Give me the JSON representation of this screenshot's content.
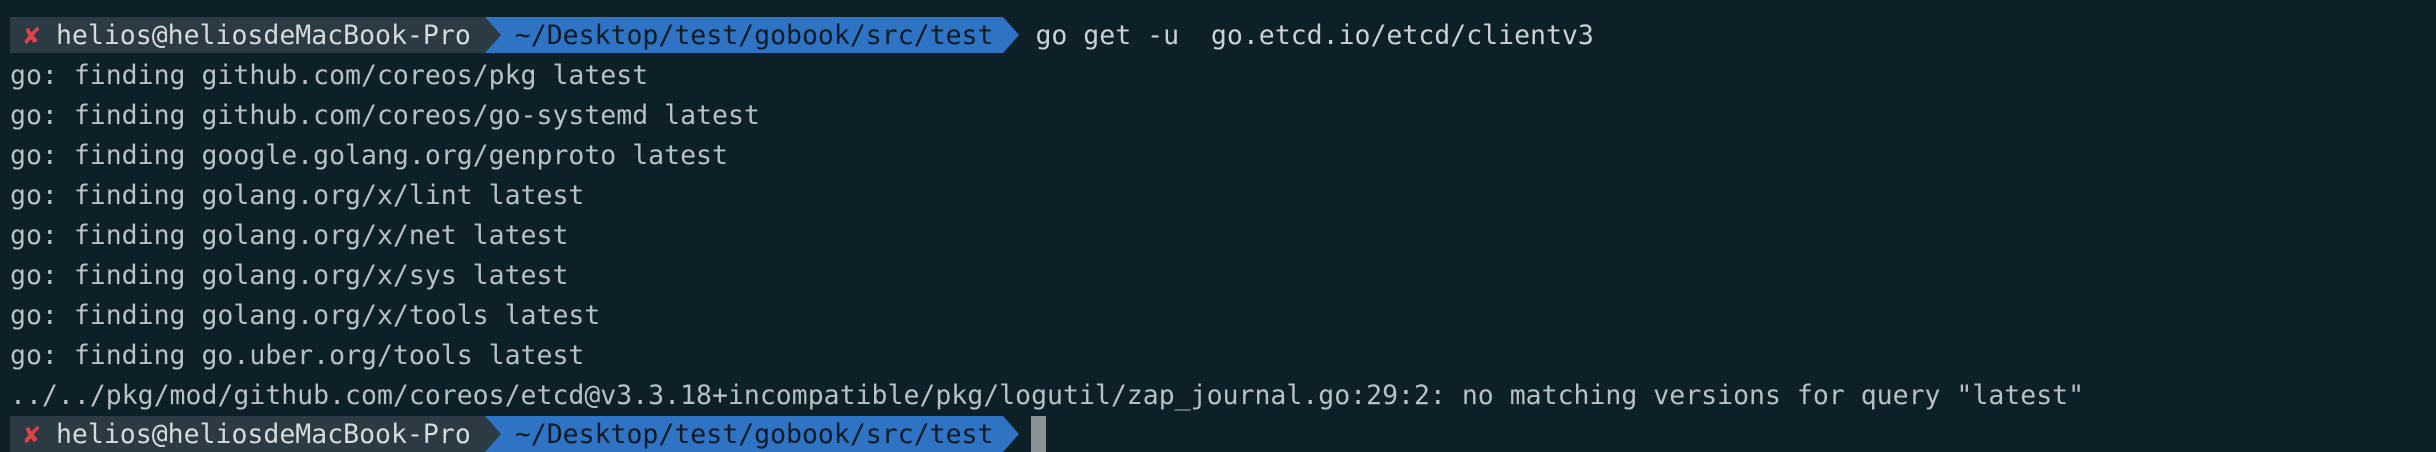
{
  "terminal": {
    "top_fragment": "~",
    "prompts": [
      {
        "status_icon": "✘",
        "user_host": "helios@heliosdeMacBook-Pro",
        "cwd": "~/Desktop/test/gobook/src/test",
        "command": "go get -u  go.etcd.io/etcd/clientv3"
      },
      {
        "status_icon": "✘",
        "user_host": "helios@heliosdeMacBook-Pro",
        "cwd": "~/Desktop/test/gobook/src/test",
        "command": ""
      }
    ],
    "output_lines": [
      "go: finding github.com/coreos/pkg latest",
      "go: finding github.com/coreos/go-systemd latest",
      "go: finding google.golang.org/genproto latest",
      "go: finding golang.org/x/lint latest",
      "go: finding golang.org/x/net latest",
      "go: finding golang.org/x/sys latest",
      "go: finding golang.org/x/tools latest",
      "go: finding go.uber.org/tools latest",
      "../../pkg/mod/github.com/coreos/etcd@v3.3.18+incompatible/pkg/logutil/zap_journal.go:29:2: no matching versions for query \"latest\""
    ]
  }
}
